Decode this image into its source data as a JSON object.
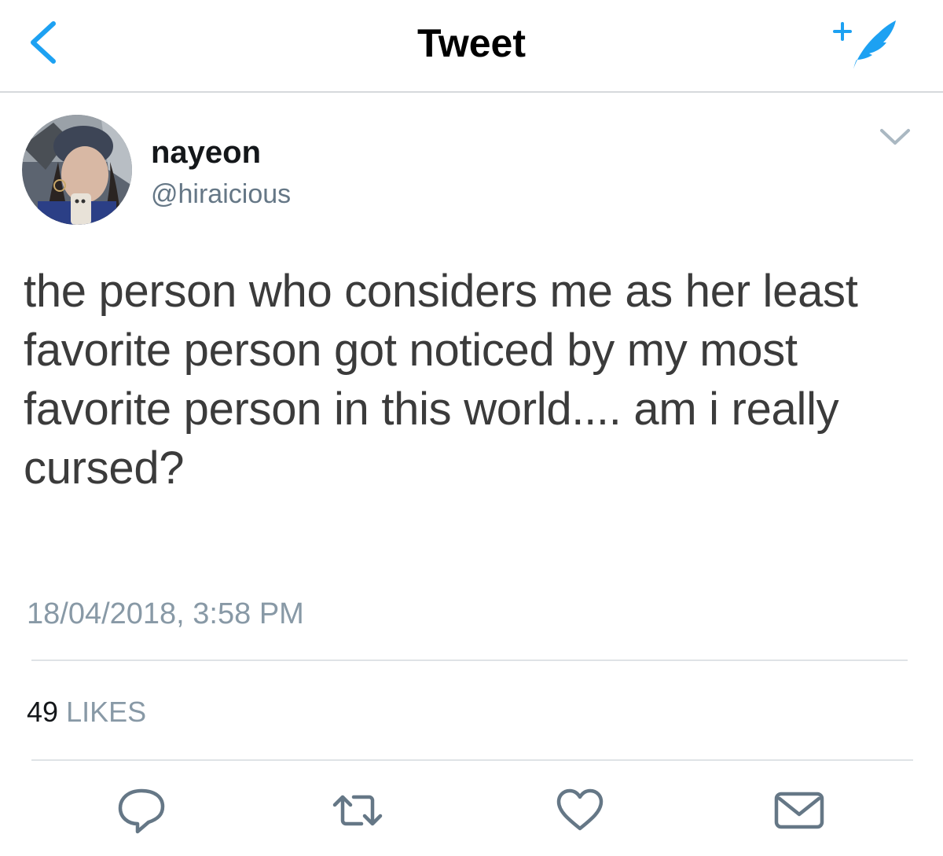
{
  "header": {
    "title": "Tweet",
    "back_icon": "chevron-left-icon",
    "compose_icon": "compose-feather-icon",
    "accent_color": "#1da1f2"
  },
  "tweet": {
    "author": {
      "name": "nayeon",
      "handle": "@hiraicious"
    },
    "text": "the person who considers me as her least favorite person got noticed by my most favorite person in this world.... am i really cursed?",
    "timestamp": "18/04/2018, 3:58 PM",
    "likes": {
      "count": "49",
      "label": "LIKES"
    }
  },
  "actions": [
    {
      "name": "reply",
      "icon": "reply-icon"
    },
    {
      "name": "retweet",
      "icon": "retweet-icon"
    },
    {
      "name": "like",
      "icon": "heart-icon"
    },
    {
      "name": "message",
      "icon": "envelope-icon"
    }
  ]
}
